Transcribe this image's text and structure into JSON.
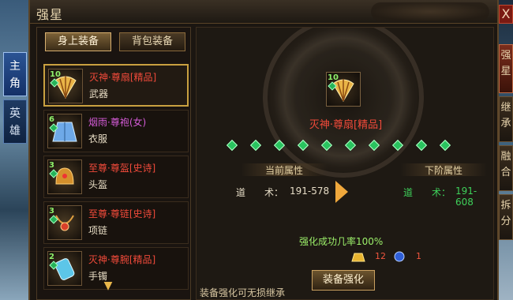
{
  "title": "强星",
  "close_label": "X",
  "left_tabs": [
    "主角",
    "英雄"
  ],
  "right_tabs": [
    "强星",
    "继承",
    "融合",
    "拆分"
  ],
  "panel_tabs": {
    "equipped": "身上装备",
    "bag": "背包装备"
  },
  "items": [
    {
      "level": "10",
      "name": "灭神·尊扇[精品]",
      "slot": "武器",
      "quality": "red",
      "icon": "fan-weapon-icon"
    },
    {
      "level": "6",
      "name": "烟雨·尊袍(女)",
      "slot": "衣服",
      "quality": "purple",
      "icon": "robe-icon"
    },
    {
      "level": "3",
      "name": "至尊·尊盔[史诗]",
      "slot": "头盔",
      "quality": "red",
      "icon": "helmet-icon"
    },
    {
      "level": "3",
      "name": "至尊·尊链[史诗]",
      "slot": "项链",
      "quality": "red",
      "icon": "necklace-icon"
    },
    {
      "level": "2",
      "name": "灭神·尊腕[精品]",
      "slot": "手镯",
      "quality": "red",
      "icon": "bracelet-icon"
    }
  ],
  "selected": {
    "level": "10",
    "name": "灭神·尊扇[精品]"
  },
  "star_count": 10,
  "current_header": "当前属性",
  "next_header": "下阶属性",
  "current_stat": {
    "label": "道　　术：",
    "value": "191-578"
  },
  "next_stat": {
    "label": "道　　术：",
    "value": "191-608"
  },
  "success_rate": "强化成功几率100%",
  "costs": [
    {
      "icon": "gold-bar-icon",
      "amount": "12"
    },
    {
      "icon": "blue-gem-icon",
      "amount": "1"
    }
  ],
  "footer_note": "装备强化可无损继承",
  "enhance_button": "装备强化",
  "colors": {
    "red": "#f04a3a",
    "purple": "#d35bd6",
    "green": "#29c35f",
    "gold": "#c9a040"
  }
}
